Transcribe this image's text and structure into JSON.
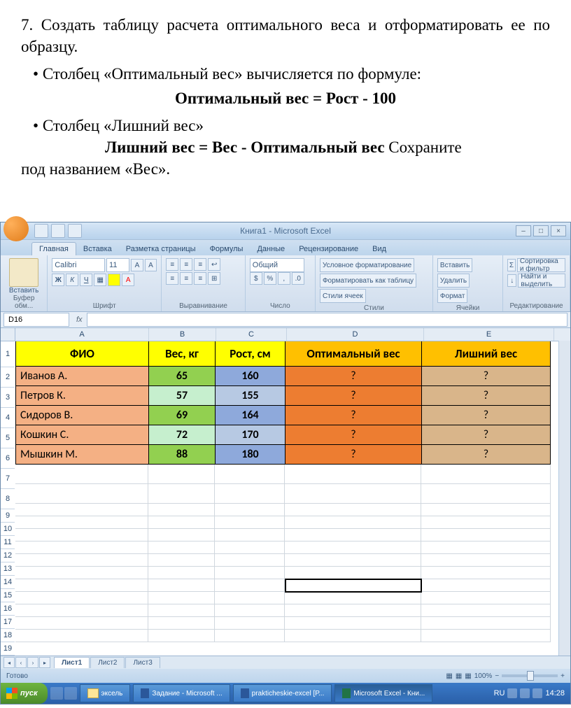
{
  "doc": {
    "task_num": "7.",
    "task_text": "Создать таблицу расчета оптимального веса и отформатировать ее по образцу.",
    "bullet1": "Столбец «Оптимальный вес» вычисляется по формуле:",
    "formula1": "Оптимальный вес = Рост - 100",
    "bullet2": "Столбец «Лишний вес»",
    "formula2_prefix": "Лишний вес = Вес - Оптимальный вес ",
    "formula2_suffix": "Сохраните",
    "save_line": "под названием «Вес»."
  },
  "excel": {
    "title": "Книга1 - Microsoft Excel",
    "tabs": [
      "Главная",
      "Вставка",
      "Разметка страницы",
      "Формулы",
      "Данные",
      "Рецензирование",
      "Вид"
    ],
    "groups": {
      "clipboard": "Буфер обм...",
      "font": "Шрифт",
      "align": "Выравнивание",
      "number": "Число",
      "styles": "Стили",
      "cells": "Ячейки",
      "edit": "Редактирование"
    },
    "font_name": "Calibri",
    "font_size": "11",
    "paste": "Вставить",
    "number_fmt": "Общий",
    "cond_fmt": "Условное форматирование",
    "fmt_table": "Форматировать как таблицу",
    "cell_styles": "Стили ячеек",
    "insert": "Вставить",
    "delete": "Удалить",
    "format": "Формат",
    "sort": "Сортировка и фильтр",
    "find": "Найти и выделить",
    "name_box": "D16",
    "col_hdrs": [
      "A",
      "B",
      "C",
      "D",
      "E"
    ],
    "table_hdr": [
      "ФИО",
      "Вес, кг",
      "Рост, см",
      "Оптимальный вес",
      "Лишний вес"
    ],
    "rows": [
      {
        "fio": "Иванов А.",
        "ves": "65",
        "rost": "160",
        "opt": "?",
        "extra": "?"
      },
      {
        "fio": "Петров К.",
        "ves": "57",
        "rost": "155",
        "opt": "?",
        "extra": "?"
      },
      {
        "fio": "Сидоров В.",
        "ves": "69",
        "rost": "164",
        "opt": "?",
        "extra": "?"
      },
      {
        "fio": "Кошкин С.",
        "ves": "72",
        "rost": "170",
        "opt": "?",
        "extra": "?"
      },
      {
        "fio": "Мышкин М.",
        "ves": "88",
        "rost": "180",
        "opt": "?",
        "extra": "?"
      }
    ],
    "sheets": [
      "Лист1",
      "Лист2",
      "Лист3"
    ],
    "status": "Готово",
    "zoom": "100%"
  },
  "taskbar": {
    "start": "пуск",
    "items": [
      {
        "label": "эксель"
      },
      {
        "label": "Задание - Microsoft ..."
      },
      {
        "label": "prakticheskie-excel [Р..."
      },
      {
        "label": "Microsoft Excel - Кни..."
      }
    ],
    "lang": "RU",
    "time": "14:28"
  }
}
